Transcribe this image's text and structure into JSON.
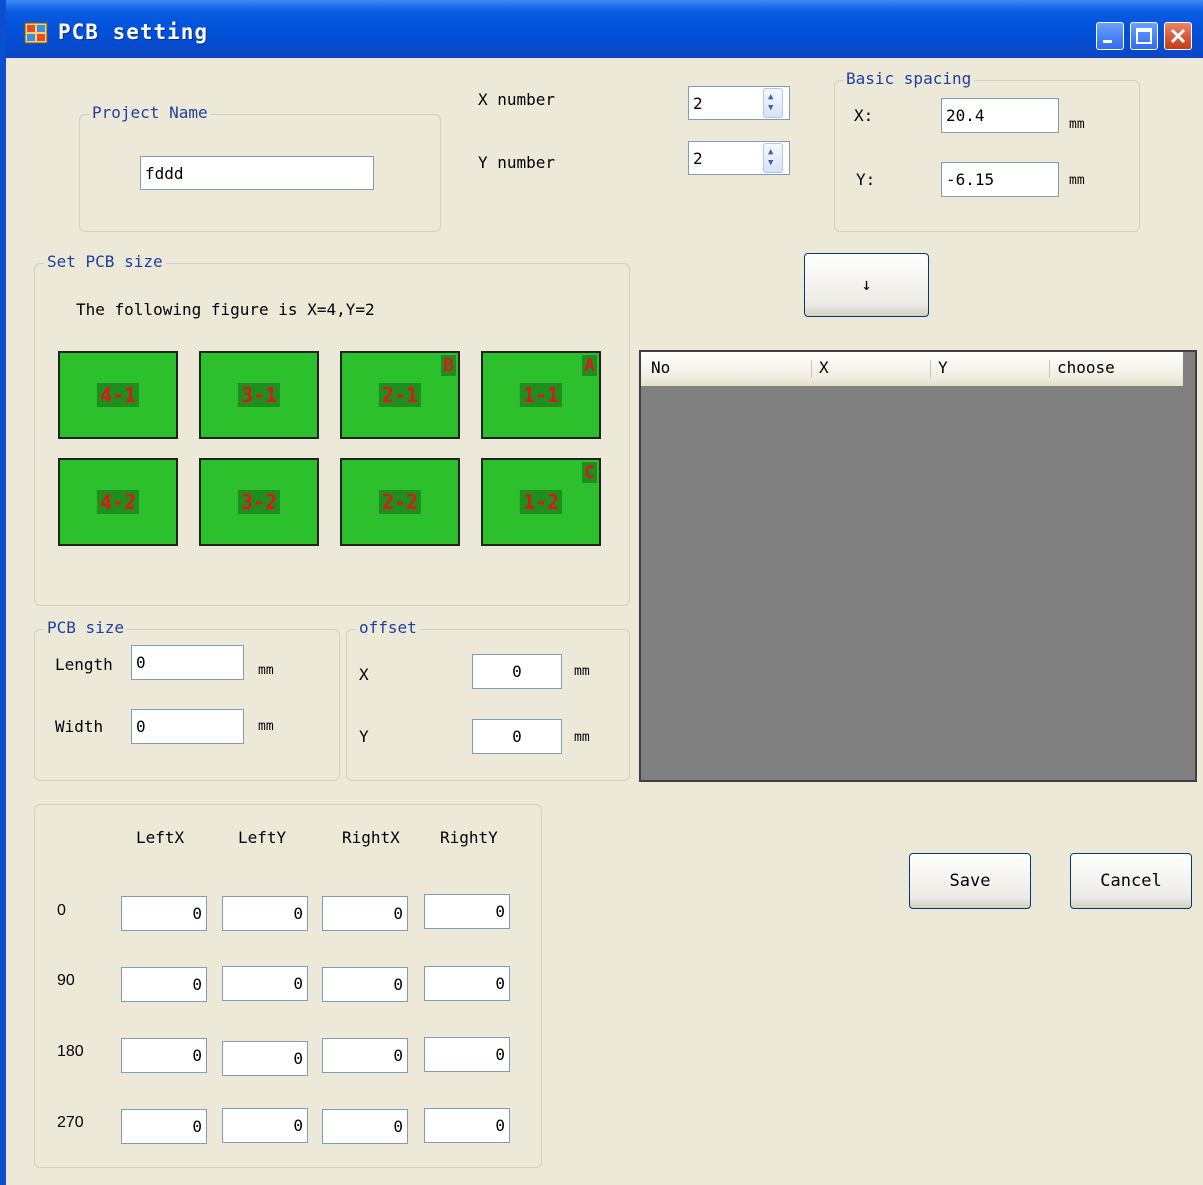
{
  "window": {
    "title": "PCB setting"
  },
  "project": {
    "legend": "Project Name",
    "value": "fddd"
  },
  "counts": {
    "x_label": "X number",
    "x_value": "2",
    "y_label": "Y number",
    "y_value": "2"
  },
  "spacing": {
    "legend": "Basic spacing",
    "x_label": "X:",
    "x_value": "20.4",
    "y_label": "Y:",
    "y_value": "-6.15",
    "unit": "mm"
  },
  "arrow_button": "↓",
  "set_size": {
    "legend": "Set PCB size",
    "caption": "The following figure is X=4,Y=2",
    "panels": [
      {
        "label": "4-1",
        "corner": ""
      },
      {
        "label": "3-1",
        "corner": ""
      },
      {
        "label": "2-1",
        "corner": "B"
      },
      {
        "label": "1-1",
        "corner": "A"
      },
      {
        "label": "4-2",
        "corner": ""
      },
      {
        "label": "3-2",
        "corner": ""
      },
      {
        "label": "2-2",
        "corner": ""
      },
      {
        "label": "1-2",
        "corner": "C"
      }
    ]
  },
  "pcb_size": {
    "legend": "PCB size",
    "length_label": "Length",
    "length_value": "0",
    "width_label": "Width",
    "width_value": "0",
    "unit": "mm"
  },
  "offset": {
    "legend": "offset",
    "x_label": "X",
    "x_value": "0",
    "y_label": "Y",
    "y_value": "0",
    "unit": "mm"
  },
  "table": {
    "columns": [
      "No",
      "X",
      "Y",
      "choose"
    ]
  },
  "angles": {
    "headers": [
      "LeftX",
      "LeftY",
      "RightX",
      "RightY"
    ],
    "rows": [
      {
        "angle": "0",
        "values": [
          "0",
          "0",
          "0",
          "0"
        ]
      },
      {
        "angle": "90",
        "values": [
          "0",
          "0",
          "0",
          "0"
        ]
      },
      {
        "angle": "180",
        "values": [
          "0",
          "0",
          "0",
          "0"
        ]
      },
      {
        "angle": "270",
        "values": [
          "0",
          "0",
          "0",
          "0"
        ]
      }
    ]
  },
  "buttons": {
    "save": "Save",
    "cancel": "Cancel"
  },
  "colors": {
    "titlebar": "#0051d8",
    "panel_green": "#2cc02c",
    "panel_text_red": "#d81a1a",
    "legend_blue": "#1f3f9e",
    "grid_bg": "#808080"
  }
}
